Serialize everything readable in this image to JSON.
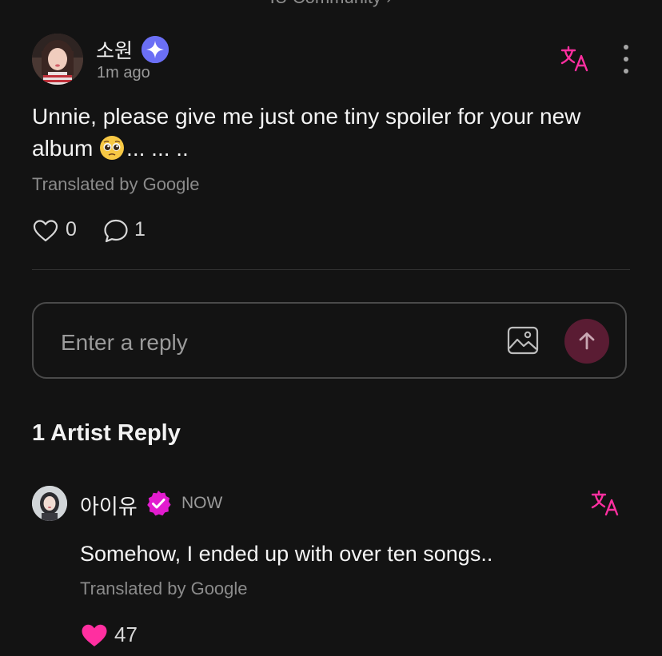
{
  "header": {
    "crumb": "IU Community ›"
  },
  "post": {
    "author": "소원",
    "time": "1m ago",
    "text": "Unnie, please give me just one tiny spoiler for your new album",
    "text_tail": "... ... ..",
    "translated_note": "Translated by Google",
    "like_count": "0",
    "comment_count": "1"
  },
  "reply_box": {
    "placeholder": "Enter a reply"
  },
  "artist_section": {
    "title": "1 Artist Reply"
  },
  "artist_reply": {
    "author": "아이유",
    "time": "NOW",
    "text": "Somehow, I ended up with over ten songs..",
    "translated_note": "Translated by Google",
    "like_count": "47"
  },
  "colors": {
    "background": "#131313",
    "accent_pink": "#ff2fa0",
    "badge_purple": "#6b6ff5",
    "verified_magenta": "#e21ccf",
    "send_button": "#5a1c33"
  },
  "icons": {
    "translate": "translate-icon",
    "more": "more-vertical-icon",
    "like_empty": "heart-outline-icon",
    "like_filled": "heart-filled-icon",
    "comment": "comment-bubble-icon",
    "image": "image-icon",
    "send": "arrow-up-icon",
    "badge_star": "sparkle-badge-icon",
    "badge_verified": "verified-check-icon"
  }
}
